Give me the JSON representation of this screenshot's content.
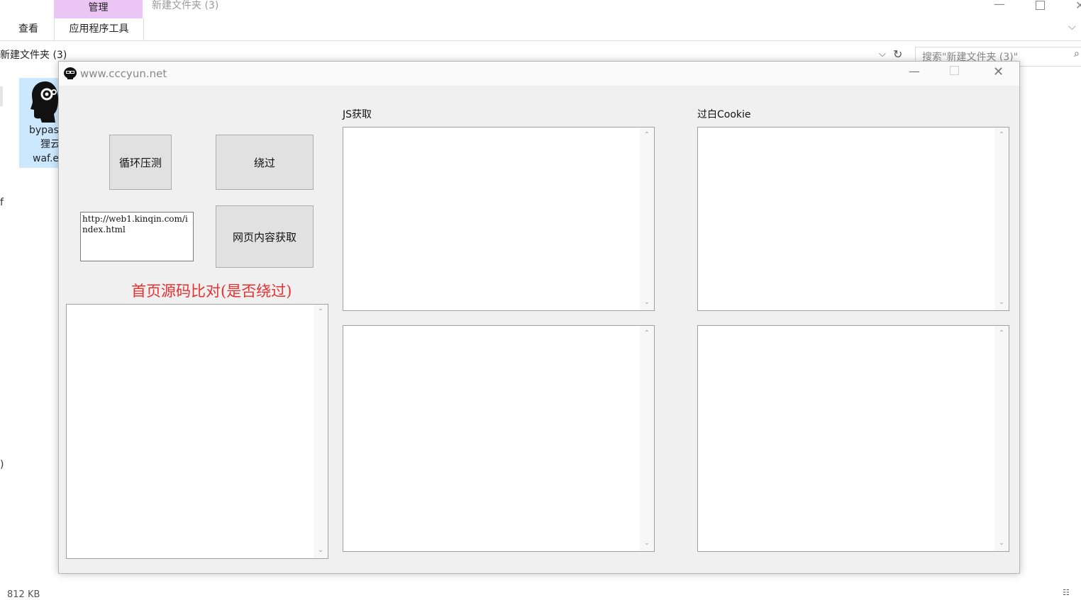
{
  "explorer": {
    "ribbon": {
      "manage_tab": "管理",
      "window_title": "新建文件夹 (3)",
      "view_tab": "查看",
      "app_tools_tab": "应用程序工具"
    },
    "address": {
      "path": "新建文件夹 (3)",
      "search_placeholder": "搜索\"新建文件夹 (3)\""
    },
    "file": {
      "line1": "bypas",
      "line2": "狸云",
      "line3": "waf.e"
    },
    "left_glyphs": {
      "g1": "f",
      "g2": ")"
    },
    "status": {
      "size": "812 KB"
    }
  },
  "dialog": {
    "title": "www.cccyun.net",
    "buttons": {
      "loop_test": "循环压测",
      "bypass": "绕过",
      "fetch_page": "网页内容获取"
    },
    "url_input": {
      "value": "http://web1.kinqin.com/index.html"
    },
    "compare_label": "首页源码比对(是否绕过)",
    "js_label": "JS获取",
    "cookie_label": "过白Cookie"
  },
  "icons": {
    "window_minimize": "minimize-icon",
    "window_maximize": "maximize-icon",
    "window_close": "close-icon",
    "refresh": "refresh-icon",
    "search": "search-icon",
    "chevron": "chevron-down-icon",
    "app_head": "head-gear-icon"
  },
  "colors": {
    "manage_tab_bg": "#ebc6f5",
    "selected_file_bg": "#cce8ff",
    "compare_label": "#e83030",
    "dialog_bg": "#f0f0f0"
  }
}
